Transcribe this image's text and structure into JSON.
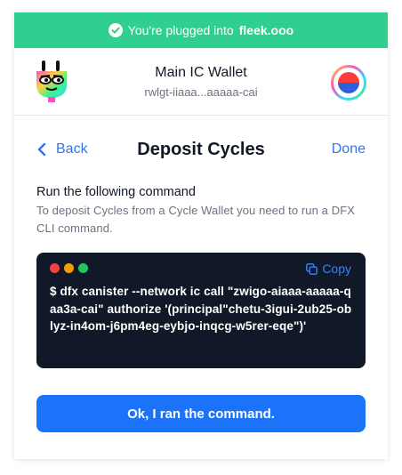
{
  "banner": {
    "prefix": "You're plugged into",
    "site": "fleek.ooo",
    "color": "#2fcf8f"
  },
  "wallet": {
    "name": "Main IC Wallet",
    "principal_short": "rwlgt-iiaaa...aaaaa-cai"
  },
  "nav": {
    "back_label": "Back",
    "title": "Deposit Cycles",
    "done_label": "Done"
  },
  "instructions": {
    "title": "Run the following command",
    "description": "To deposit Cycles from a Cycle Wallet you need to run a DFX CLI command."
  },
  "code": {
    "copy_label": "Copy",
    "command": "$ dfx canister --network ic call \"zwigo-aiaaa-aaaaa-qaa3a-cai\" authorize '(principal\"chetu-3igui-2ub25-oblyz-in4om-j6pm4eg-eybjo-inqcg-w5rer-eqe\")'",
    "dots": [
      "#ef4444",
      "#f59e0b",
      "#22c55e"
    ]
  },
  "actions": {
    "confirm_label": "Ok, I ran the command."
  },
  "colors": {
    "accent": "#3574f0",
    "primary_button": "#1a73f8",
    "code_bg": "#111827"
  }
}
